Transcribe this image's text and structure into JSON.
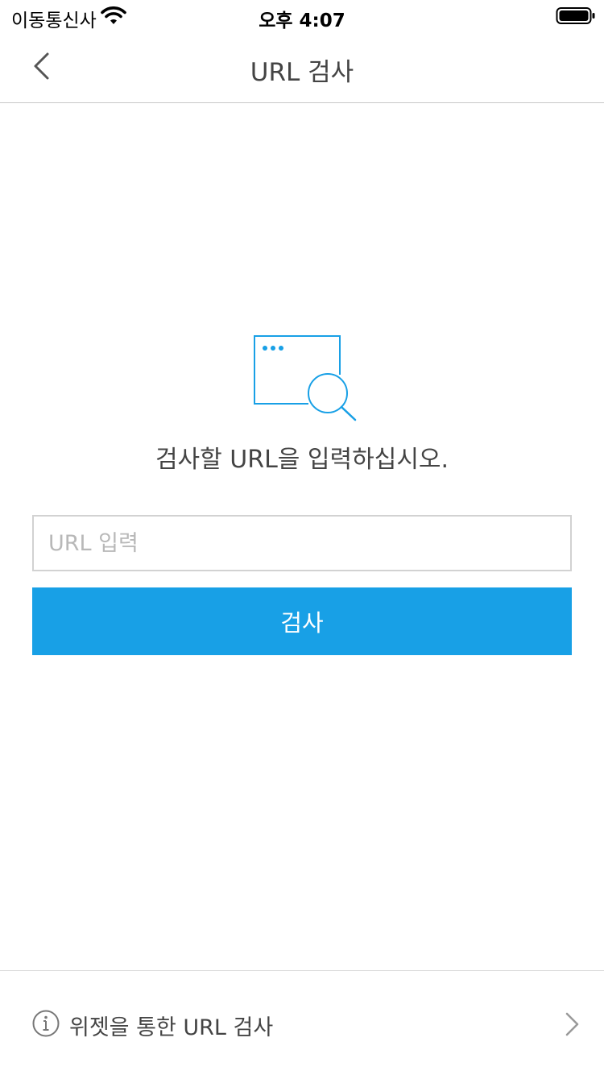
{
  "status_bar": {
    "carrier": "이동통신사",
    "time": "오후 4:07",
    "wifi_icon": "wifi-icon",
    "battery_icon": "battery-icon"
  },
  "nav": {
    "back_icon": "chevron-left-icon",
    "title": "URL 검사"
  },
  "main": {
    "illustration_icon": "browser-window-magnifier-icon",
    "prompt": "검사할 URL을 입력하십시오.",
    "url_input": {
      "placeholder": "URL 입력",
      "value": ""
    },
    "search_button_label": "검사"
  },
  "bottom": {
    "info_icon": "info-icon",
    "label": "위젯을 통한 URL 검사",
    "chevron_icon": "chevron-right-icon"
  },
  "colors": {
    "accent": "#18a0e6",
    "text": "#444444",
    "divider": "#c8c8c8"
  }
}
